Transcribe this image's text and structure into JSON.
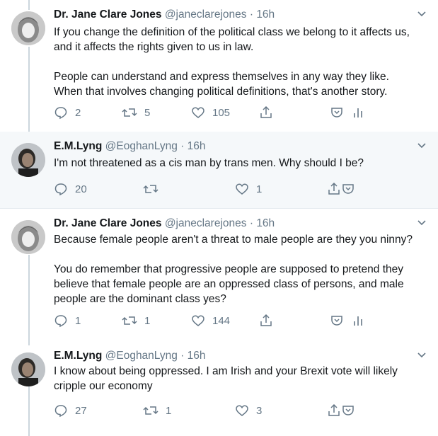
{
  "tweets": [
    {
      "name": "Dr. Jane Clare Jones",
      "handle": "@janeclarejones",
      "dot": "·",
      "time": "16h",
      "text": "If you change the definition of the political class we belong to it affects us,\nand it affects the rights given to us in law.\n\nPeople can understand and express themselves in any way they like.\nWhen that involves changing political definitions, that's another story.",
      "replies": "2",
      "retweets": "5",
      "likes": "105"
    },
    {
      "name": "E.M.Lyng",
      "handle": "@EoghanLyng",
      "dot": "·",
      "time": "16h",
      "text": "I'm not threatened as a cis man by trans men. Why should I be?",
      "replies": "20",
      "retweets": "",
      "likes": "1"
    },
    {
      "name": "Dr. Jane Clare Jones",
      "handle": "@janeclarejones",
      "dot": "·",
      "time": "16h",
      "text": "Because female people aren't a threat to male people are they you ninny?\n\nYou do remember that progressive people are supposed to pretend they\nbelieve that female people are an oppressed class of persons, and male\npeople are the dominant class yes?",
      "replies": "1",
      "retweets": "1",
      "likes": "144"
    },
    {
      "name": "E.M.Lyng",
      "handle": "@EoghanLyng",
      "dot": "·",
      "time": "16h",
      "text": "I know about being oppressed. I am Irish and your Brexit vote will likely\ncripple our economy",
      "replies": "27",
      "retweets": "1",
      "likes": "3"
    }
  ],
  "colors": {
    "muted": "#657786",
    "highlight_bg": "#f5f8fa",
    "thread_line": "#ccd6dd"
  }
}
